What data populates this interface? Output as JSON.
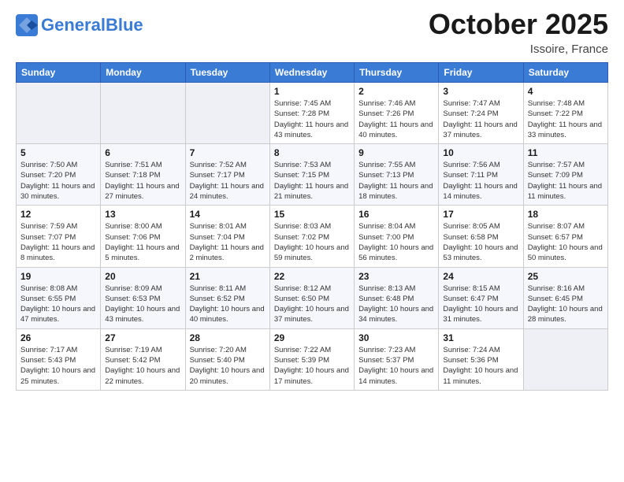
{
  "header": {
    "logo_line1": "General",
    "logo_line2": "Blue",
    "month_title": "October 2025",
    "location": "Issoire, France"
  },
  "weekdays": [
    "Sunday",
    "Monday",
    "Tuesday",
    "Wednesday",
    "Thursday",
    "Friday",
    "Saturday"
  ],
  "weeks": [
    [
      {
        "day": "",
        "info": ""
      },
      {
        "day": "",
        "info": ""
      },
      {
        "day": "",
        "info": ""
      },
      {
        "day": "1",
        "info": "Sunrise: 7:45 AM\nSunset: 7:28 PM\nDaylight: 11 hours and 43 minutes."
      },
      {
        "day": "2",
        "info": "Sunrise: 7:46 AM\nSunset: 7:26 PM\nDaylight: 11 hours and 40 minutes."
      },
      {
        "day": "3",
        "info": "Sunrise: 7:47 AM\nSunset: 7:24 PM\nDaylight: 11 hours and 37 minutes."
      },
      {
        "day": "4",
        "info": "Sunrise: 7:48 AM\nSunset: 7:22 PM\nDaylight: 11 hours and 33 minutes."
      }
    ],
    [
      {
        "day": "5",
        "info": "Sunrise: 7:50 AM\nSunset: 7:20 PM\nDaylight: 11 hours and 30 minutes."
      },
      {
        "day": "6",
        "info": "Sunrise: 7:51 AM\nSunset: 7:18 PM\nDaylight: 11 hours and 27 minutes."
      },
      {
        "day": "7",
        "info": "Sunrise: 7:52 AM\nSunset: 7:17 PM\nDaylight: 11 hours and 24 minutes."
      },
      {
        "day": "8",
        "info": "Sunrise: 7:53 AM\nSunset: 7:15 PM\nDaylight: 11 hours and 21 minutes."
      },
      {
        "day": "9",
        "info": "Sunrise: 7:55 AM\nSunset: 7:13 PM\nDaylight: 11 hours and 18 minutes."
      },
      {
        "day": "10",
        "info": "Sunrise: 7:56 AM\nSunset: 7:11 PM\nDaylight: 11 hours and 14 minutes."
      },
      {
        "day": "11",
        "info": "Sunrise: 7:57 AM\nSunset: 7:09 PM\nDaylight: 11 hours and 11 minutes."
      }
    ],
    [
      {
        "day": "12",
        "info": "Sunrise: 7:59 AM\nSunset: 7:07 PM\nDaylight: 11 hours and 8 minutes."
      },
      {
        "day": "13",
        "info": "Sunrise: 8:00 AM\nSunset: 7:06 PM\nDaylight: 11 hours and 5 minutes."
      },
      {
        "day": "14",
        "info": "Sunrise: 8:01 AM\nSunset: 7:04 PM\nDaylight: 11 hours and 2 minutes."
      },
      {
        "day": "15",
        "info": "Sunrise: 8:03 AM\nSunset: 7:02 PM\nDaylight: 10 hours and 59 minutes."
      },
      {
        "day": "16",
        "info": "Sunrise: 8:04 AM\nSunset: 7:00 PM\nDaylight: 10 hours and 56 minutes."
      },
      {
        "day": "17",
        "info": "Sunrise: 8:05 AM\nSunset: 6:58 PM\nDaylight: 10 hours and 53 minutes."
      },
      {
        "day": "18",
        "info": "Sunrise: 8:07 AM\nSunset: 6:57 PM\nDaylight: 10 hours and 50 minutes."
      }
    ],
    [
      {
        "day": "19",
        "info": "Sunrise: 8:08 AM\nSunset: 6:55 PM\nDaylight: 10 hours and 47 minutes."
      },
      {
        "day": "20",
        "info": "Sunrise: 8:09 AM\nSunset: 6:53 PM\nDaylight: 10 hours and 43 minutes."
      },
      {
        "day": "21",
        "info": "Sunrise: 8:11 AM\nSunset: 6:52 PM\nDaylight: 10 hours and 40 minutes."
      },
      {
        "day": "22",
        "info": "Sunrise: 8:12 AM\nSunset: 6:50 PM\nDaylight: 10 hours and 37 minutes."
      },
      {
        "day": "23",
        "info": "Sunrise: 8:13 AM\nSunset: 6:48 PM\nDaylight: 10 hours and 34 minutes."
      },
      {
        "day": "24",
        "info": "Sunrise: 8:15 AM\nSunset: 6:47 PM\nDaylight: 10 hours and 31 minutes."
      },
      {
        "day": "25",
        "info": "Sunrise: 8:16 AM\nSunset: 6:45 PM\nDaylight: 10 hours and 28 minutes."
      }
    ],
    [
      {
        "day": "26",
        "info": "Sunrise: 7:17 AM\nSunset: 5:43 PM\nDaylight: 10 hours and 25 minutes."
      },
      {
        "day": "27",
        "info": "Sunrise: 7:19 AM\nSunset: 5:42 PM\nDaylight: 10 hours and 22 minutes."
      },
      {
        "day": "28",
        "info": "Sunrise: 7:20 AM\nSunset: 5:40 PM\nDaylight: 10 hours and 20 minutes."
      },
      {
        "day": "29",
        "info": "Sunrise: 7:22 AM\nSunset: 5:39 PM\nDaylight: 10 hours and 17 minutes."
      },
      {
        "day": "30",
        "info": "Sunrise: 7:23 AM\nSunset: 5:37 PM\nDaylight: 10 hours and 14 minutes."
      },
      {
        "day": "31",
        "info": "Sunrise: 7:24 AM\nSunset: 5:36 PM\nDaylight: 10 hours and 11 minutes."
      },
      {
        "day": "",
        "info": ""
      }
    ]
  ]
}
